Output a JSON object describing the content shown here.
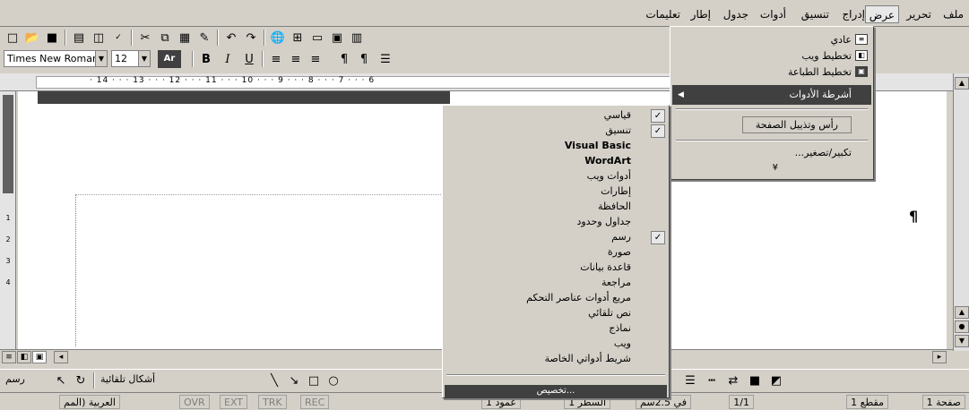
{
  "menubar": {
    "items": [
      "ملف",
      "تحرير",
      "عرض",
      "إدراج",
      "تنسيق",
      "أدوات",
      "جدول",
      "إطار",
      "تعليمات"
    ],
    "active": "عرض"
  },
  "toolbar2": {
    "font": "Times New Roman",
    "size": "12",
    "style_btn": "Ar",
    "bold": "B",
    "italic": "I",
    "underline": "U"
  },
  "ruler": {
    "ticks": "· 14 · · · 13 · · · 12 · · · 11 · · · 10 · · · 9 · · · 8 · · · 7 · · · 6"
  },
  "vruler": {
    "nums": [
      "1",
      "2",
      "3",
      "4"
    ]
  },
  "view_menu": {
    "items": [
      "عادي",
      "تخطيط ويب",
      "تخطيط الطباعة"
    ],
    "toolbars": "أشرطة الأدوات",
    "header_footer": "رأس وتذييل الصفحة",
    "zoom": "تكبير/تصغير...",
    "more": "¥"
  },
  "toolbars_menu": {
    "items": [
      {
        "label": "قياسي",
        "checked": true,
        "rtl": true
      },
      {
        "label": "تنسيق",
        "checked": true,
        "rtl": true
      },
      {
        "label": "Visual Basic",
        "checked": false,
        "rtl": false
      },
      {
        "label": "WordArt",
        "checked": false,
        "rtl": false
      },
      {
        "label": "أدوات ويب",
        "checked": false,
        "rtl": true
      },
      {
        "label": "إطارات",
        "checked": false,
        "rtl": true
      },
      {
        "label": "الحافظة",
        "checked": false,
        "rtl": true
      },
      {
        "label": "جداول وحدود",
        "checked": false,
        "rtl": true
      },
      {
        "label": "رسم",
        "checked": true,
        "rtl": true
      },
      {
        "label": "صورة",
        "checked": false,
        "rtl": true
      },
      {
        "label": "قاعدة بيانات",
        "checked": false,
        "rtl": true
      },
      {
        "label": "مراجعة",
        "checked": false,
        "rtl": true
      },
      {
        "label": "مربع أدوات عناصر التحكم",
        "checked": false,
        "rtl": true
      },
      {
        "label": "نص تلقائي",
        "checked": false,
        "rtl": true
      },
      {
        "label": "نماذج",
        "checked": false,
        "rtl": true
      },
      {
        "label": "ويب",
        "checked": false,
        "rtl": true
      },
      {
        "label": "شريط أدواتي الخاصة",
        "checked": false,
        "rtl": true
      }
    ],
    "customize": "تخصيص..."
  },
  "pilcrow": "¶",
  "drawbar": {
    "draw": "رسم",
    "autoshapes": "أشكال تلقائية"
  },
  "statusbar": {
    "page": "صفحة 1",
    "section": "مقطع 1",
    "pages": "1/1",
    "at": "في 2.5سم",
    "line": "السطر 1",
    "col": "عمود 1",
    "rec": "REC",
    "trk": "TRK",
    "ext": "EXT",
    "ovr": "OVR",
    "lang": "العربية (المم"
  }
}
